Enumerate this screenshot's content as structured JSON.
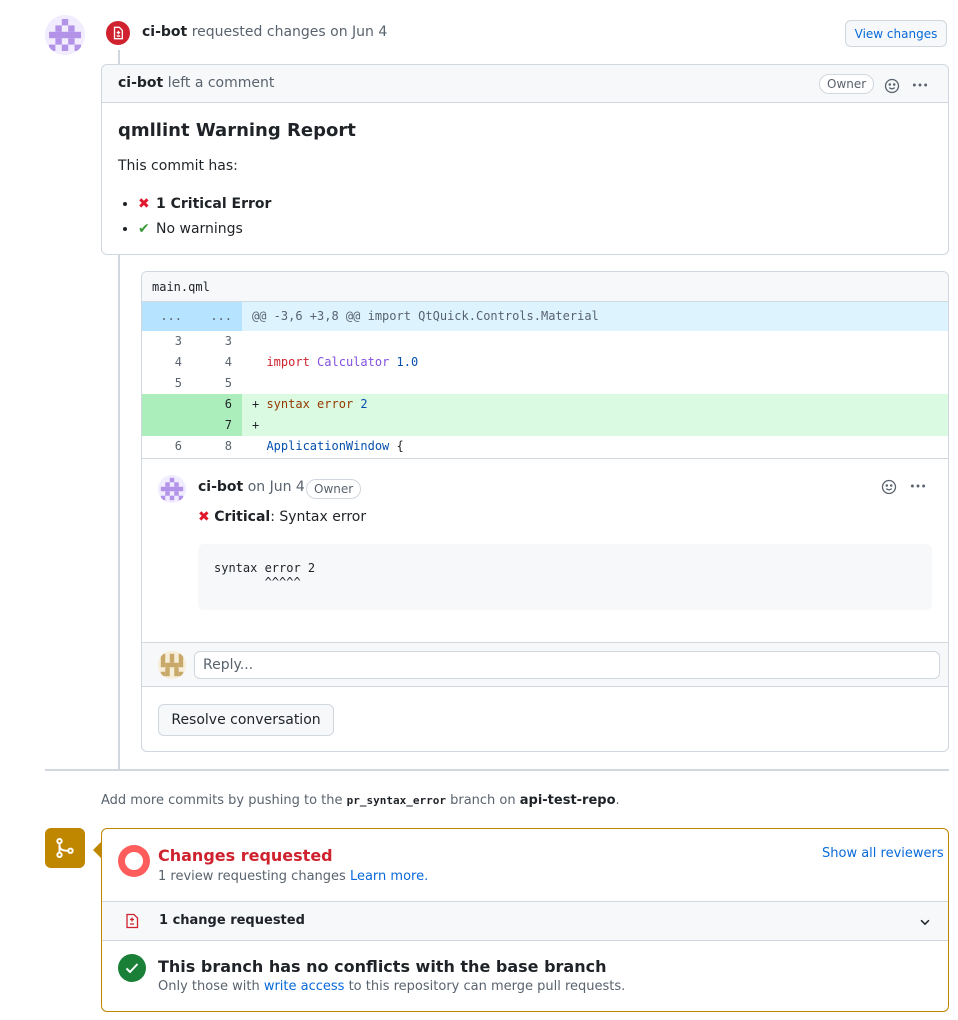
{
  "review": {
    "author": "ci-bot",
    "action": "requested changes on Jun 4",
    "view_changes_label": "View changes"
  },
  "comment": {
    "author": "ci-bot",
    "action": "left a comment",
    "owner_label": "Owner",
    "title": "qmllint Warning Report",
    "intro": "This commit has:",
    "items": [
      {
        "icon": "cross-mark-icon",
        "text": "1 Critical Error",
        "bold": true
      },
      {
        "icon": "check-mark-icon",
        "text": "No warnings",
        "bold": false
      }
    ]
  },
  "diff": {
    "file_name": "main.qml",
    "hunk": {
      "left": "...",
      "right": "...",
      "text": "@@ -3,6 +3,8 @@ import QtQuick.Controls.Material"
    },
    "lines": [
      {
        "old": "3",
        "new": "3",
        "sign": " ",
        "tokens": []
      },
      {
        "old": "4",
        "new": "4",
        "sign": " ",
        "tokens": [
          {
            "t": "import",
            "c": "kw"
          },
          {
            "t": " ",
            "c": ""
          },
          {
            "t": "Calculator",
            "c": "cls"
          },
          {
            "t": " ",
            "c": ""
          },
          {
            "t": "1.0",
            "c": "num"
          }
        ]
      },
      {
        "old": "5",
        "new": "5",
        "sign": " ",
        "tokens": []
      },
      {
        "old": "",
        "new": "6",
        "sign": "+",
        "tokens": [
          {
            "t": "syntax",
            "c": "str"
          },
          {
            "t": " ",
            "c": ""
          },
          {
            "t": "error",
            "c": "str"
          },
          {
            "t": " ",
            "c": ""
          },
          {
            "t": "2",
            "c": "num"
          }
        ]
      },
      {
        "old": "",
        "new": "7",
        "sign": "+",
        "tokens": []
      },
      {
        "old": "6",
        "new": "8",
        "sign": " ",
        "tokens": [
          {
            "t": "ApplicationWindow",
            "c": "ent"
          },
          {
            "t": " {",
            "c": ""
          }
        ]
      }
    ]
  },
  "inline_comment": {
    "author": "ci-bot",
    "date": "on Jun 4",
    "owner_label": "Owner",
    "severity": "Critical",
    "message": ": Syntax error",
    "code": "syntax error 2\n       ^^^^^"
  },
  "reply": {
    "placeholder": "Reply..."
  },
  "resolve_label": "Resolve conversation",
  "push_hint": {
    "prefix": "Add more commits by pushing to the ",
    "branch": "pr_syntax_error",
    "middle": " branch on ",
    "repo": "api-test-repo",
    "suffix": "."
  },
  "merge": {
    "status_title": "Changes requested",
    "status_sub": "1 review requesting changes ",
    "learn_more": "Learn more.",
    "show_reviewers": "Show all reviewers",
    "change_count_label": "1 change requested",
    "conflict_title": "This branch has no conflicts with the base branch",
    "conflict_sub_prefix": "Only those with ",
    "conflict_sub_link": "write access",
    "conflict_sub_suffix": " to this repository can merge pull requests."
  },
  "colors": {
    "danger": "#cf222e",
    "success": "#1a7f37",
    "attention": "#bf8700",
    "accent": "#0969da"
  }
}
